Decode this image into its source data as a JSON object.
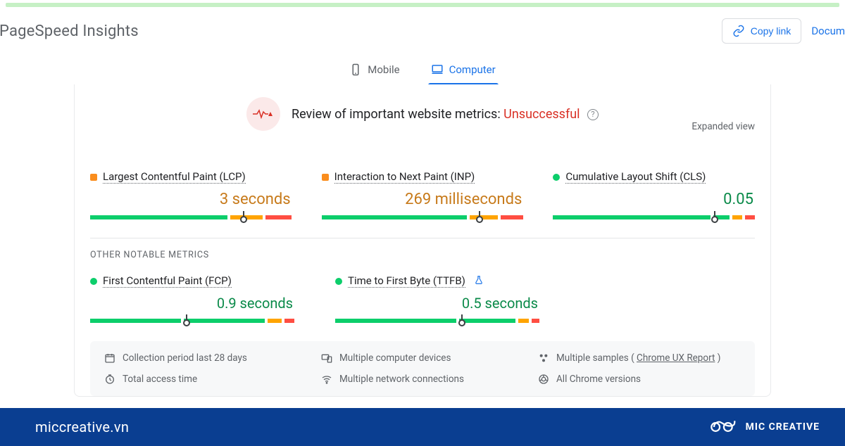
{
  "header": {
    "title": "PageSpeed Insights",
    "copy_link": "Copy link",
    "docs": "Docum"
  },
  "tabs": {
    "mobile": "Mobile",
    "computer": "Computer"
  },
  "review": {
    "label": "Review of important website metrics: ",
    "status": "Unsuccessful",
    "expanded": "Expanded view"
  },
  "metrics": {
    "lcp": {
      "name": "Largest Contentful Paint (LCP)",
      "value": "3 seconds"
    },
    "inp": {
      "name": "Interaction to Next Paint (INP)",
      "value": "269 milliseconds"
    },
    "cls": {
      "name": "Cumulative Layout Shift (CLS)",
      "value": "0.05"
    },
    "fcp": {
      "name": "First Contentful Paint (FCP)",
      "value": "0.9 seconds"
    },
    "ttfb": {
      "name": "Time to First Byte (TTFB)",
      "value": "0.5 seconds"
    }
  },
  "section": {
    "other": "OTHER NOTABLE METRICS"
  },
  "footer": {
    "period": "Collection period last 28 days",
    "devices": "Multiple computer devices",
    "samples_prefix": "Multiple samples ( ",
    "samples_link": "Chrome UX Report",
    "samples_suffix": " )",
    "total": "Total access time",
    "network": "Multiple network connections",
    "chrome": "All Chrome versions"
  },
  "brand": {
    "domain": "miccreative.vn",
    "name": "MIC CREATIVE"
  }
}
